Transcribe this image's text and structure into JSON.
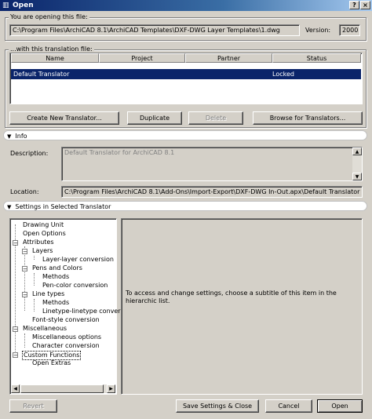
{
  "window": {
    "title": "Open",
    "icon": "app-icon",
    "help_label": "?",
    "close_label": "×"
  },
  "file": {
    "legend": "You are opening this file:",
    "path": "C:\\Program Files\\ArchiCAD 8.1\\ArchiCAD Templates\\DXF-DWG Layer Templates\\1.dwg",
    "version_label": "Version:",
    "version_value": "2000"
  },
  "translation": {
    "legend": "...with this translation file:",
    "columns": [
      "Name",
      "Project",
      "Partner",
      "Status"
    ],
    "rows": [
      {
        "name": "Default Translator",
        "project": "",
        "partner": "",
        "status": "Locked",
        "selected": true
      }
    ],
    "buttons": {
      "create": "Create New Translator...",
      "duplicate": "Duplicate",
      "delete": "Delete",
      "browse": "Browse for Translators..."
    }
  },
  "info": {
    "section_label": "Info",
    "description_label": "Description:",
    "description_value": "Default Translator for ArchiCAD 8.1",
    "location_label": "Location:",
    "location_value": "C:\\Program Files\\ArchiCAD 8.1\\Add-Ons\\Import-Export\\DXF-DWG In-Out.apx\\Default Translator"
  },
  "settings": {
    "section_label": "Settings in Selected Translator",
    "tree": [
      "Drawing Unit",
      "Open Options",
      "Attributes",
      "Layers",
      "Layer-layer conversion",
      "Pens and Colors",
      "Methods",
      "Pen-color conversion",
      "Line types",
      "Methods",
      "Linetype-linetype conversion",
      "Font-style conversion",
      "Miscellaneous",
      "Miscellaneous options",
      "Character conversion",
      "Custom Functions",
      "Open Extras"
    ],
    "hint": "To access and change settings, choose a subtitle of this item in the hierarchic list."
  },
  "footer": {
    "revert": "Revert",
    "save_close": "Save Settings & Close",
    "cancel": "Cancel",
    "open": "Open"
  },
  "colors": {
    "selection": "#0a246a",
    "titlebar": "#0a246a",
    "face": "#d4d0c8"
  }
}
